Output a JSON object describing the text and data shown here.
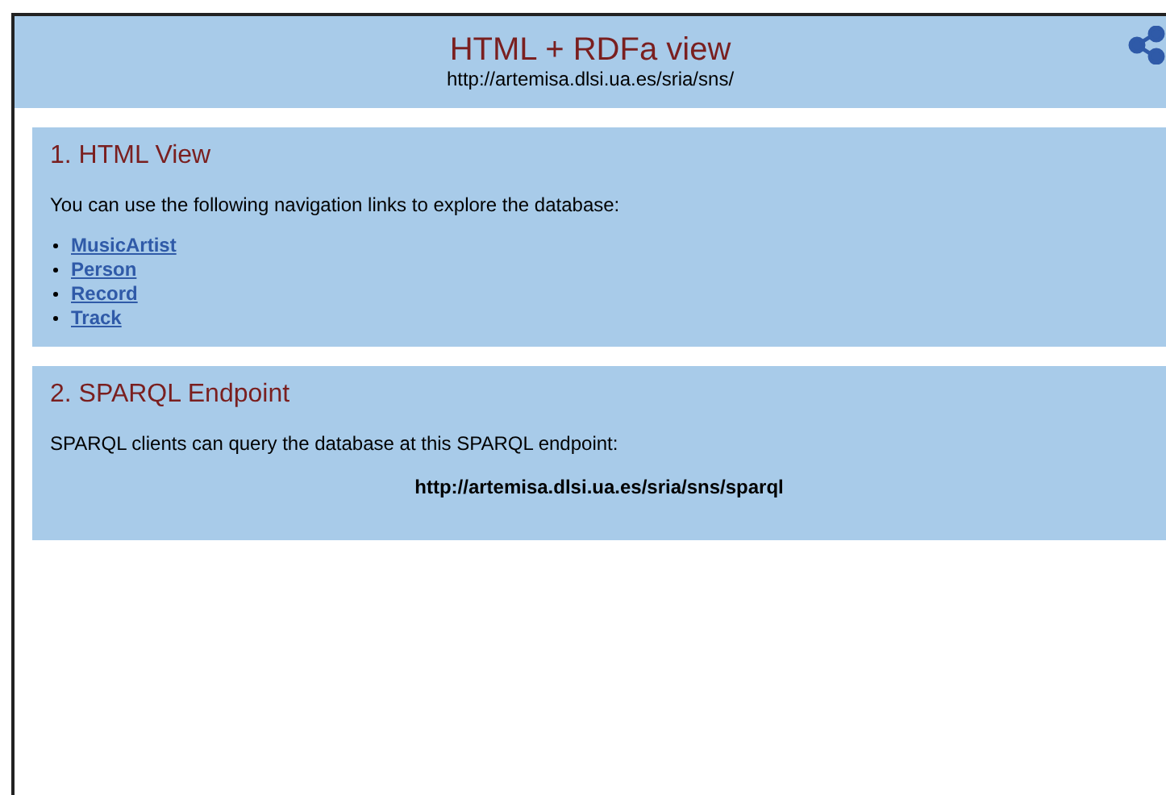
{
  "header": {
    "title": "HTML + RDFa view",
    "url": "http://artemisa.dlsi.ua.es/sria/sns/"
  },
  "sections": [
    {
      "kind": "links",
      "heading": "1. HTML View",
      "text": "You can use the following navigation links to explore the database:",
      "links": [
        "MusicArtist",
        "Person",
        "Record",
        "Track"
      ]
    },
    {
      "kind": "endpoint",
      "heading": "2. SPARQL Endpoint",
      "text": "SPARQL clients can query the database at this SPARQL endpoint:",
      "endpoint": "http://artemisa.dlsi.ua.es/sria/sns/sparql"
    }
  ]
}
